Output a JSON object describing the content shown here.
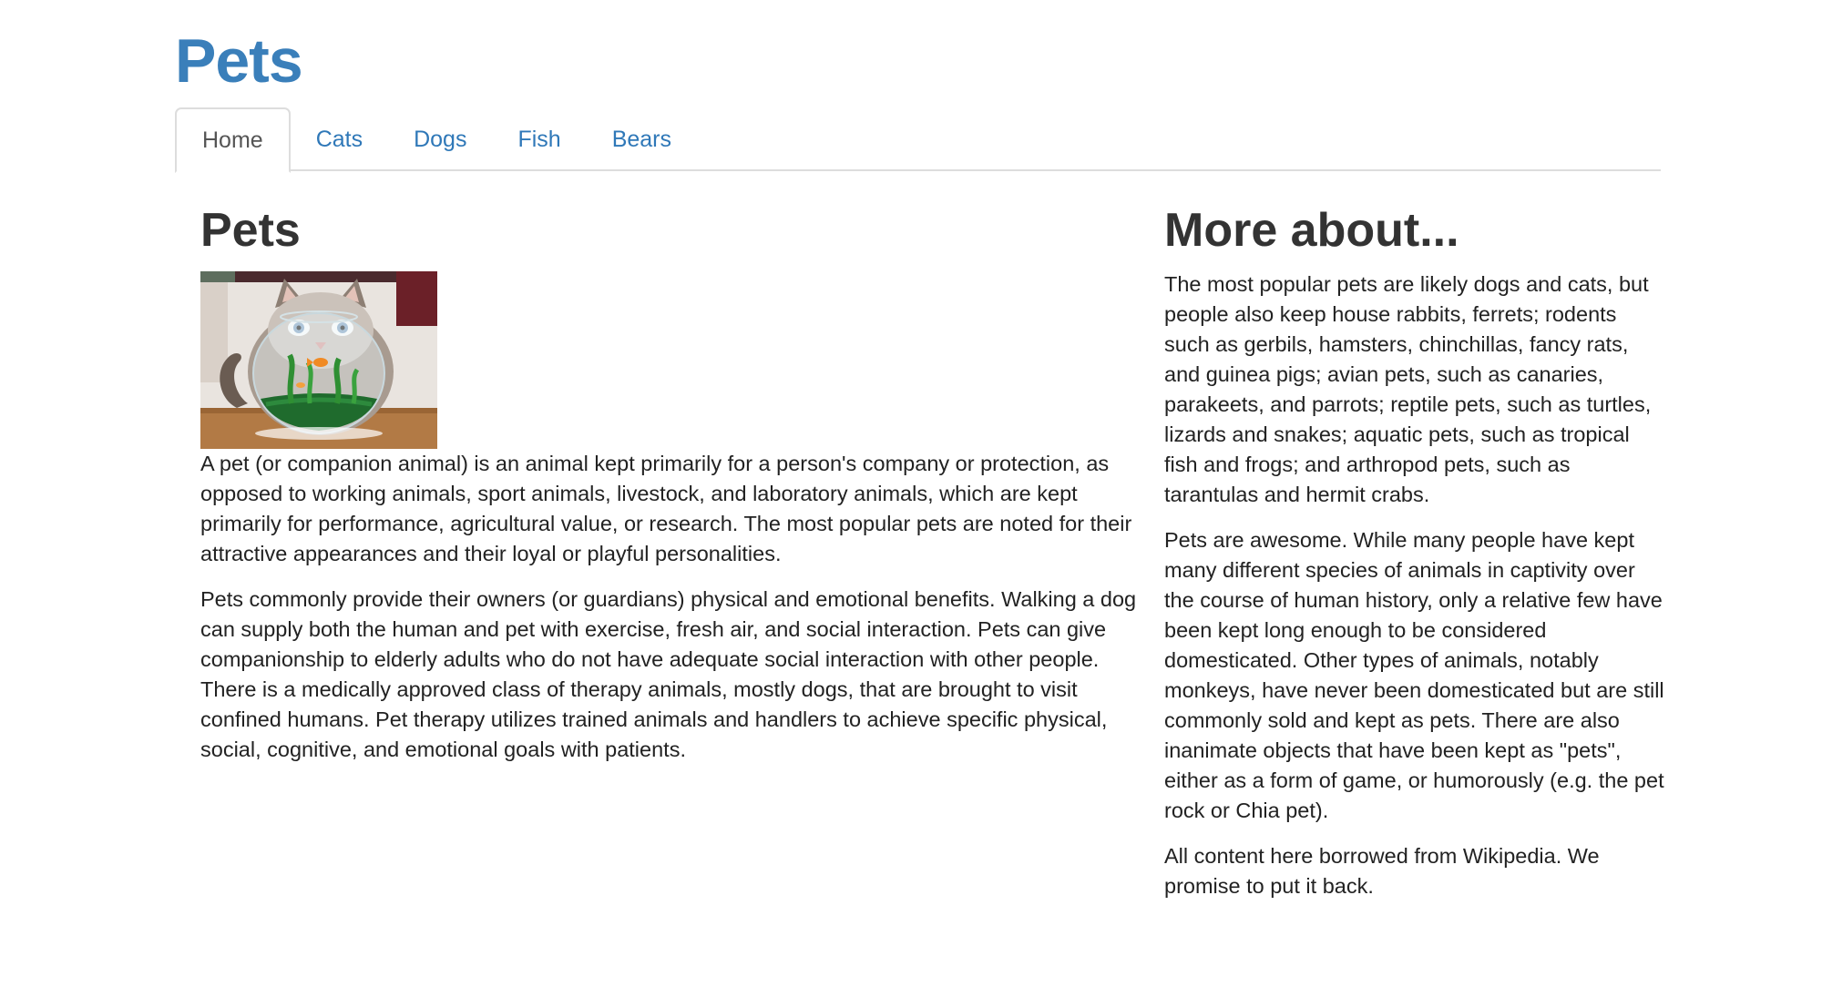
{
  "header": {
    "site_title": "Pets"
  },
  "nav": {
    "tabs": [
      {
        "label": "Home",
        "active": true
      },
      {
        "label": "Cats",
        "active": false
      },
      {
        "label": "Dogs",
        "active": false
      },
      {
        "label": "Fish",
        "active": false
      },
      {
        "label": "Bears",
        "active": false
      }
    ]
  },
  "main": {
    "heading": "Pets",
    "image_icon": "cat-behind-fishbowl-photo",
    "paragraphs": [
      "A pet (or companion animal) is an animal kept primarily for a person's company or protection, as opposed to working animals, sport animals, livestock, and laboratory animals, which are kept primarily for performance, agricultural value, or research. The most popular pets are noted for their attractive appearances and their loyal or playful personalities.",
      "Pets commonly provide their owners (or guardians) physical and emotional benefits. Walking a dog can supply both the human and pet with exercise, fresh air, and social interaction. Pets can give companionship to elderly adults who do not have adequate social interaction with other people. There is a medically approved class of therapy animals, mostly dogs, that are brought to visit confined humans. Pet therapy utilizes trained animals and handlers to achieve specific physical, social, cognitive, and emotional goals with patients."
    ]
  },
  "aside": {
    "heading": "More about...",
    "paragraphs": [
      "The most popular pets are likely dogs and cats, but people also keep house rabbits, ferrets; rodents such as gerbils, hamsters, chinchillas, fancy rats, and guinea pigs; avian pets, such as canaries, parakeets, and parrots; reptile pets, such as turtles, lizards and snakes; aquatic pets, such as tropical fish and frogs; and arthropod pets, such as tarantulas and hermit crabs.",
      "Pets are awesome. While many people have kept many different species of animals in captivity over the course of human history, only a relative few have been kept long enough to be considered domesticated. Other types of animals, notably monkeys, have never been domesticated but are still commonly sold and kept as pets. There are also inanimate objects that have been kept as \"pets\", either as a form of game, or humorously (e.g. the pet rock or Chia pet).",
      "All content here borrowed from Wikipedia. We promise to put it back."
    ]
  },
  "colors": {
    "brand": "#3a7fba",
    "link": "#2f78b8",
    "text": "#222222",
    "border": "#dddddd"
  }
}
